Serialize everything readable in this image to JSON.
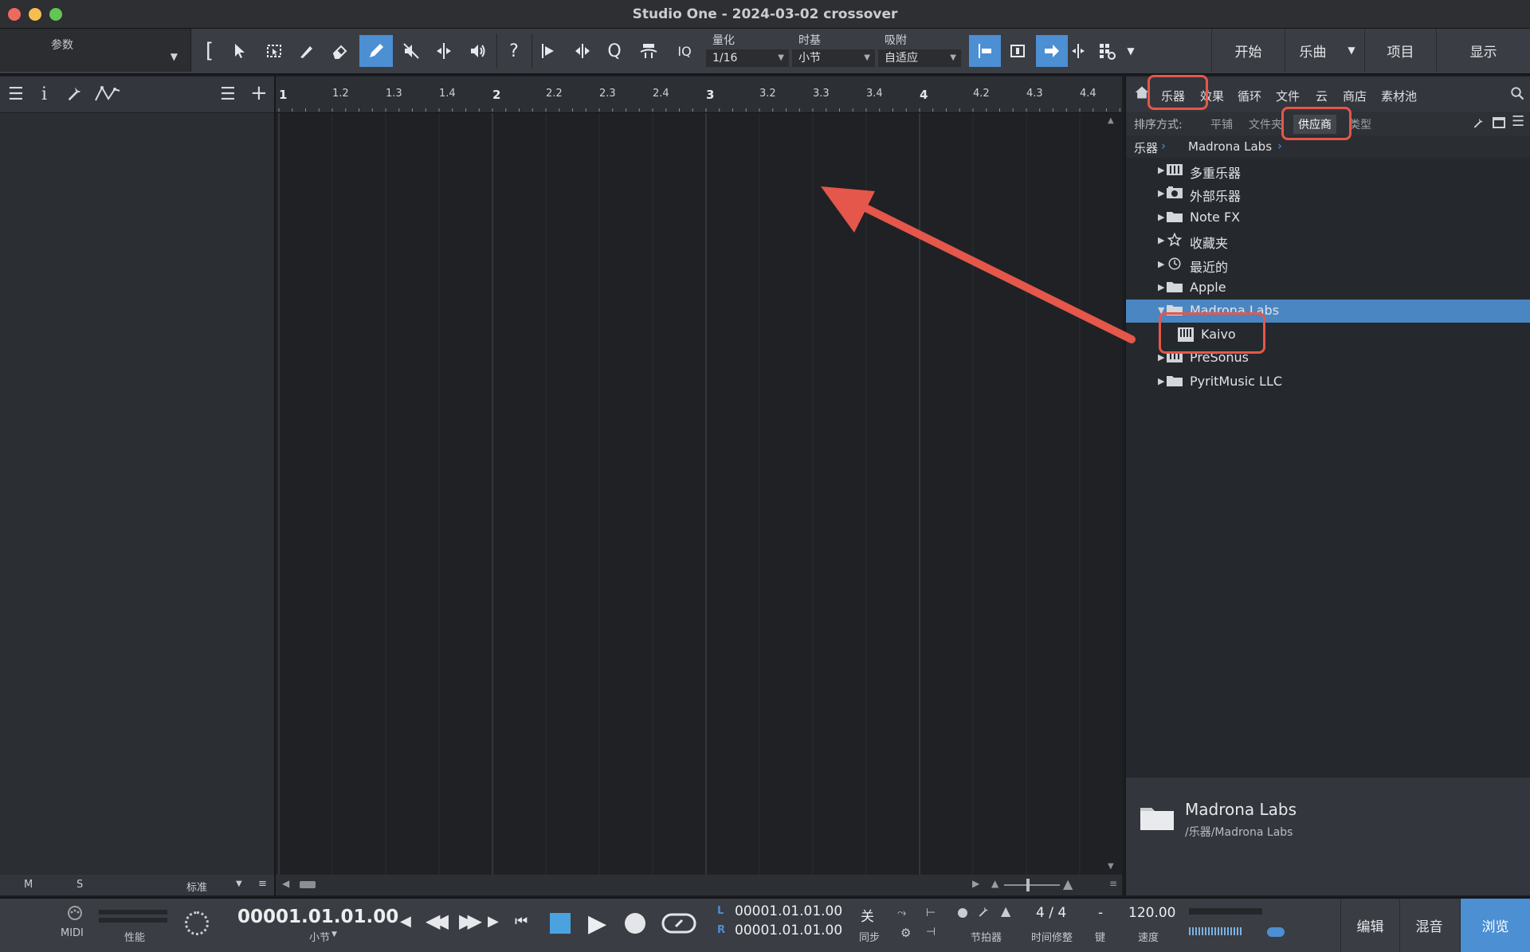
{
  "window": {
    "title": "Studio One - 2024-03-02 crossover",
    "traffic_colors": [
      "#ed6a5e",
      "#f5bf4f",
      "#62c654"
    ]
  },
  "toolbar": {
    "param_label": "参数",
    "iq_label": "IQ",
    "quantize": {
      "label": "量化",
      "value": "1/16"
    },
    "timebase": {
      "label": "时基",
      "value": "小节"
    },
    "snap": {
      "label": "吸附",
      "value": "自适应"
    },
    "buttons": {
      "start": "开始",
      "song": "乐曲",
      "project": "项目",
      "show": "显示"
    },
    "accent": "#4c8fd3"
  },
  "inspector": {
    "footer": {
      "m": "M",
      "s": "S",
      "mode": "标准"
    }
  },
  "ruler": {
    "labels": [
      "1",
      "1.2",
      "1.3",
      "1.4",
      "2",
      "2.2",
      "2.3",
      "2.4",
      "3",
      "3.2",
      "3.3",
      "3.4",
      "4",
      "4.2",
      "4.3",
      "4.4"
    ]
  },
  "browser": {
    "tabs": [
      "乐器",
      "效果",
      "循环",
      "文件",
      "云",
      "商店",
      "素材池"
    ],
    "sort": {
      "label": "排序方式:",
      "options": [
        "平铺",
        "文件夹",
        "供应商",
        "类型"
      ],
      "active": "供应商"
    },
    "breadcrumb": [
      "乐器",
      "Madrona Labs"
    ],
    "tree": [
      {
        "label": "多重乐器",
        "icon": "multi-instrument-icon"
      },
      {
        "label": "外部乐器",
        "icon": "external-instrument-icon"
      },
      {
        "label": "Note FX",
        "icon": "folder-icon"
      },
      {
        "label": "收藏夹",
        "icon": "star-icon"
      },
      {
        "label": "最近的",
        "icon": "clock-icon"
      },
      {
        "label": "Apple",
        "icon": "folder-icon"
      },
      {
        "label": "Madrona Labs",
        "icon": "folder-icon",
        "selected": true,
        "expanded": true
      },
      {
        "label": "Kaivo",
        "icon": "vst-plugin-icon",
        "child": true
      },
      {
        "label": "PreSonus",
        "icon": "keyboard-icon"
      },
      {
        "label": "PyritMusic LLC",
        "icon": "folder-icon"
      }
    ],
    "info": {
      "name": "Madrona Labs",
      "path": "/乐器/Madrona Labs"
    }
  },
  "transport": {
    "midi_label": "MIDI",
    "perf_label": "性能",
    "position": "00001.01.01.00",
    "position_unit": "小节",
    "loop_l_label": "L",
    "loop_l": "00001.01.01.00",
    "loop_r_label": "R",
    "loop_r": "00001.01.01.00",
    "sync_value": "关",
    "sync_label": "同步",
    "metronome_label": "节拍器",
    "timesig": "4 / 4",
    "timesig_label": "时间修整",
    "key_value": "-",
    "key_label": "键",
    "tempo": "120.00",
    "tempo_label": "速度",
    "pages": {
      "edit": "编辑",
      "mix": "混音",
      "browse": "浏览"
    }
  },
  "annotation_color": "#e4574a"
}
